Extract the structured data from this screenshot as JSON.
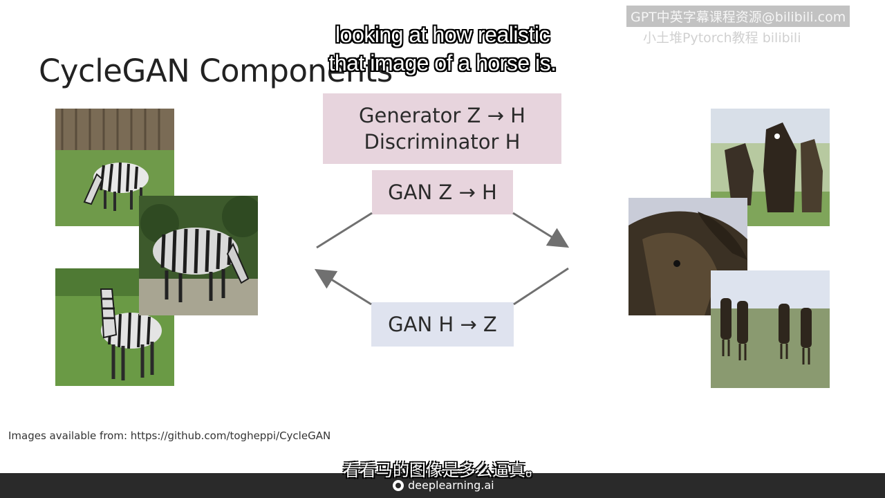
{
  "slide": {
    "title": "CycleGAN Components",
    "top_box": {
      "line1": "Generator Z → H",
      "line2": "Discriminator H"
    },
    "gan_zh_label": "GAN Z → H",
    "gan_hz_label": "GAN H → Z",
    "source_note": "Images available from: https://github.com/togheppi/CycleGAN",
    "left_images": [
      "zebra-grazing-photo",
      "zebra-standing-photo",
      "zebra-front-photo"
    ],
    "right_images": [
      "horses-group-photo",
      "horse-closeup-photo",
      "horses-field-photo"
    ]
  },
  "subtitles": {
    "english_line1": "looking at how realistic",
    "english_line2": "that image of a horse is.",
    "chinese": "看看马的图像是多么逼真。"
  },
  "watermark": {
    "line1": "GPT中英字幕课程资源@bilibili.com",
    "line2": "小土堆Pytorch教程 bilibili"
  },
  "footer": {
    "brand": "deeplearning.ai"
  },
  "colors": {
    "pink_box": "#e7d4dd",
    "blue_box": "#dfe3ef",
    "arrow": "#707070",
    "footer_bar": "#2a2a2a"
  }
}
